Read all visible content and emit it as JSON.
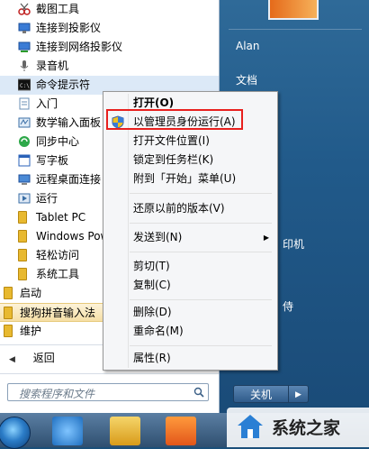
{
  "programs": [
    {
      "label": "截图工具",
      "icon": "scissors-icon"
    },
    {
      "label": "连接到投影仪",
      "icon": "projector-icon"
    },
    {
      "label": "连接到网络投影仪",
      "icon": "network-projector-icon"
    },
    {
      "label": "录音机",
      "icon": "microphone-icon"
    },
    {
      "label": "命令提示符",
      "icon": "cmd-icon"
    },
    {
      "label": "入门",
      "icon": "document-icon"
    },
    {
      "label": "数学输入面板",
      "icon": "math-input-icon"
    },
    {
      "label": "同步中心",
      "icon": "sync-icon"
    },
    {
      "label": "写字板",
      "icon": "wordpad-icon"
    },
    {
      "label": "远程桌面连接",
      "icon": "remote-desktop-icon"
    },
    {
      "label": "运行",
      "icon": "run-icon"
    },
    {
      "label": "Tablet PC",
      "icon": "folder-icon"
    },
    {
      "label": "Windows Powe",
      "icon": "folder-icon"
    },
    {
      "label": "轻松访问",
      "icon": "folder-icon"
    },
    {
      "label": "系统工具",
      "icon": "folder-icon"
    },
    {
      "label": "启动",
      "icon": "folder-icon"
    },
    {
      "label": "搜狗拼音输入法",
      "icon": "folder-icon"
    },
    {
      "label": "维护",
      "icon": "folder-icon"
    }
  ],
  "back_label": "返回",
  "search_placeholder": "搜索程序和文件",
  "right_pane": {
    "user": "Alan",
    "documents": "文档",
    "printers_partial": "印机",
    "partial2": "侍",
    "shutdown": "关机",
    "shutdown_arrow": "▶"
  },
  "context_menu": [
    {
      "label": "打开(O)",
      "bold": true
    },
    {
      "label": "以管理员身份运行(A)",
      "shield": true
    },
    {
      "label": "打开文件位置(I)"
    },
    {
      "label": "锁定到任务栏(K)"
    },
    {
      "label": "附到「开始」菜单(U)"
    },
    {
      "label": "还原以前的版本(V)"
    },
    {
      "label": "发送到(N)",
      "submenu": true
    },
    {
      "label": "剪切(T)"
    },
    {
      "label": "复制(C)"
    },
    {
      "label": "删除(D)"
    },
    {
      "label": "重命名(M)"
    },
    {
      "label": "属性(R)"
    }
  ],
  "watermark": "系统之家",
  "colors": {
    "highlight_border": "#e8201e",
    "start_right": "#215a8a"
  }
}
